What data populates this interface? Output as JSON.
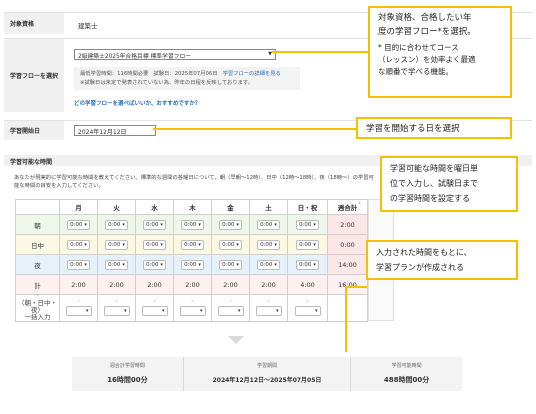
{
  "qualification": {
    "label": "対象資格",
    "value": "建築士"
  },
  "flow": {
    "label": "学習フローを選択",
    "selected": "2級建築士2025年合格目標 標準学習フロー",
    "info_line1_a": "最低学習時間：116時間必要",
    "info_line1_b": "試験日：2025年07月06日",
    "info_line1_link": "学習フローの詳細を見る",
    "info_line2": "※試験日は未定で発表されていない為、昨年の日程を反映しております。",
    "help_link": "どの学習フローを選べばいいか、おすすめですか？"
  },
  "start": {
    "label": "学習開始日",
    "value": "2024年12月12日"
  },
  "availability": {
    "heading": "学習可能な時間",
    "description": "あなたが現実的に学習可能な時間を教えてください。標準的な週間の各曜日について、朝（早朝〜12時）、日中（12時〜18時）、夜（18時〜）の学習可能な時間の目安を入力してください。",
    "days": [
      "月",
      "火",
      "水",
      "木",
      "金",
      "土",
      "日・祝"
    ],
    "sum_header": "週合計",
    "rows": [
      {
        "label": "朝",
        "cells": [
          "0:00",
          "0:00",
          "0:00",
          "0:00",
          "0:00",
          "0:00",
          "0:00"
        ],
        "sum": "2:00"
      },
      {
        "label": "日中",
        "cells": [
          "0:00",
          "0:00",
          "0:00",
          "0:00",
          "0:00",
          "0:00",
          "0:00"
        ],
        "sum": "0:00"
      },
      {
        "label": "夜",
        "cells": [
          "0:00",
          "0:00",
          "0:00",
          "0:00",
          "0:00",
          "0:00",
          "0:00"
        ],
        "sum": "14:00"
      }
    ],
    "total_label": "計",
    "totals": [
      "2:00",
      "2:00",
      "2:00",
      "2:00",
      "2:00",
      "2:00",
      "4:00"
    ],
    "total_sum": "16:00",
    "bulk_label_line1": "（朝・日中・夜）",
    "bulk_label_line2": "一括入力",
    "side_arrow": "‹",
    "chevron": "▾",
    "up_arrow": "⌃"
  },
  "summary": {
    "items": [
      {
        "label": "週合計学習時間",
        "value": "16時間00分"
      },
      {
        "label": "学習期間",
        "value": "2024年12月12日〜2025年07月05日"
      },
      {
        "label": "学習可能時間",
        "value": "488時間00分"
      }
    ]
  },
  "callouts": {
    "flow_line1": "対象資格、合格したい年",
    "flow_line2": "度の学習フロー*を選択。",
    "flow_note1": "* 目的に合わせてコース",
    "flow_note2": "（レッスン）を効率よく最適",
    "flow_note3": "な順番で学べる機能。",
    "start": "学習を開始する日を選択",
    "time_line1": "学習可能な時間を曜日単",
    "time_line2": "位で入力し、試験日まで",
    "time_line3": "の学習時間を設定する",
    "plan_line1": "入力された時間をもとに、",
    "plan_line2": "学習プランが作成される"
  },
  "colors": {
    "callout_border": "#f2c200",
    "morning": "#eef7ea",
    "noon": "#fdf8e3",
    "night": "#e6f1fa",
    "total": "#fdf0f1",
    "link": "#2a6bbf"
  }
}
